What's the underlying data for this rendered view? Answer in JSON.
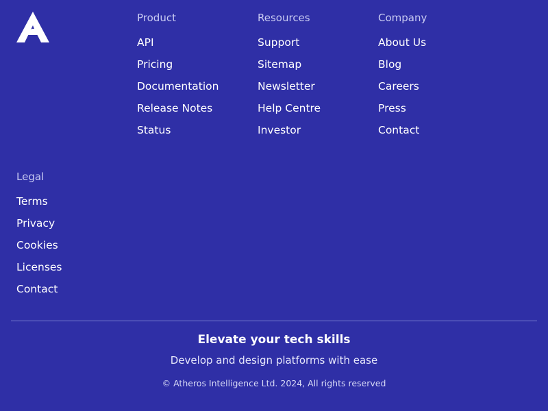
{
  "brand": {
    "logo_icon": "atheros-a-logo-icon"
  },
  "columns": {
    "product": {
      "title": "Product",
      "links": [
        "API",
        "Pricing",
        "Documentation",
        "Release Notes",
        "Status"
      ]
    },
    "resources": {
      "title": "Resources",
      "links": [
        "Support",
        "Sitemap",
        "Newsletter",
        "Help Centre",
        "Investor"
      ]
    },
    "company": {
      "title": "Company",
      "links": [
        "About Us",
        "Blog",
        "Careers",
        "Press",
        "Contact"
      ]
    },
    "legal": {
      "title": "Legal",
      "links": [
        "Terms",
        "Privacy",
        "Cookies",
        "Licenses",
        "Contact"
      ]
    }
  },
  "bottom": {
    "tagline": "Elevate your tech skills",
    "subline": "Develop and design platforms with ease",
    "copyright": "© Atheros Intelligence Ltd. 2024, All rights reserved"
  },
  "colors": {
    "background": "#2f2fa6",
    "heading": "#c9cbf2",
    "link": "#ffffff",
    "divider": "#7b7fd0"
  }
}
